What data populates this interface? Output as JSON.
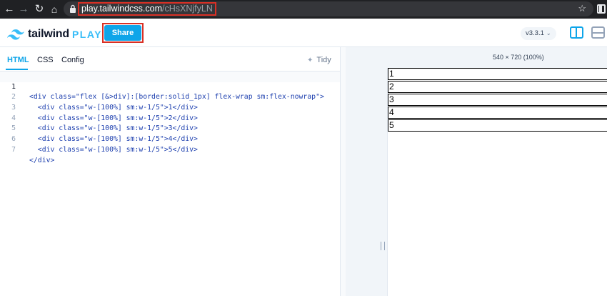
{
  "browser": {
    "url_host": "play.tailwindcss.com",
    "url_path": "/cHsXNjfyLN",
    "icons": [
      "back-icon",
      "forward-icon",
      "reload-icon",
      "lock-icon",
      "star-icon",
      "extensions-icon"
    ]
  },
  "header": {
    "logo_word": "tailwind",
    "logo_play": "PLAY",
    "share_label": "Share",
    "version": "v3.3.1",
    "accent_color": "#0ea5e9"
  },
  "editor": {
    "tabs": [
      {
        "label": "HTML",
        "active": true
      },
      {
        "label": "CSS",
        "active": false
      },
      {
        "label": "Config",
        "active": false
      }
    ],
    "tidy_label": "Tidy",
    "lines": [
      {
        "num": "1",
        "text": "<div class=\"flex [&>div]:[border:solid_1px] flex-wrap sm:flex-nowrap\">"
      },
      {
        "num": "2",
        "text": "  <div class=\"w-[100%] sm:w-1/5\">1</div>"
      },
      {
        "num": "3",
        "text": "  <div class=\"w-[100%] sm:w-1/5\">2</div>"
      },
      {
        "num": "4",
        "text": "  <div class=\"w-[100%] sm:w-1/5\">3</div>"
      },
      {
        "num": "5",
        "text": "  <div class=\"w-[100%] sm:w-1/5\">4</div>"
      },
      {
        "num": "6",
        "text": "  <div class=\"w-[100%] sm:w-1/5\">5</div>"
      },
      {
        "num": "7",
        "text": "</div>"
      }
    ]
  },
  "preview": {
    "size_label": "540 × 720 (100%)",
    "boxes": [
      "1",
      "2",
      "3",
      "4",
      "5"
    ]
  }
}
